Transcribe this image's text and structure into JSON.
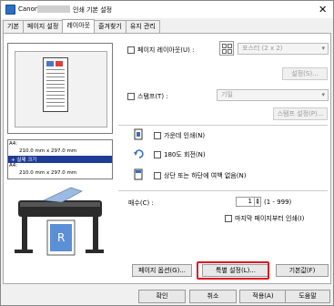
{
  "window": {
    "title_prefix": "Canon",
    "title_suffix": "인쇄 기본 설정",
    "close": "✕"
  },
  "tabs": [
    {
      "label": "기본"
    },
    {
      "label": "페이지 설정"
    },
    {
      "label": "레이아웃"
    },
    {
      "label": "즐겨찾기"
    },
    {
      "label": "유지 관리"
    }
  ],
  "preview": {
    "size_lines": [
      "A4:",
      "210.0 mm x 297.0 mm",
      "+ 실제 크기",
      "A4:",
      "210.0 mm x 297.0 mm"
    ]
  },
  "layout": {
    "page_layout_label": "페이지 레이아웃(U) :",
    "page_layout_value": "포스터 (2 x 2)",
    "settings_button": "설정(S)...",
    "stamp_label": "스탬프(T) :",
    "stamp_value": "기밀",
    "stamp_settings_button": "스탬프 설정(P)...",
    "center_print_label": "가운데 인쇄(N)",
    "rotate_label": "180도 회전(N)",
    "no_margin_label": "상단 또는 하단에 여백 없음(N)",
    "copies_label": "매수(C) :",
    "copies_value": "1",
    "copies_range": "(1 - 999)",
    "reverse_label": "마지막 페이지부터 인쇄(I)",
    "page_options_button": "페이지 옵션(G)...",
    "special_settings_button": "특별 설정(L)...",
    "defaults_button": "기본값(F)"
  },
  "footer": {
    "ok": "확인",
    "cancel": "취소",
    "apply": "적용(A)",
    "help": "도움말"
  },
  "colors": {
    "highlight": "#1e3c96",
    "emphasis_ring": "#e0141e"
  }
}
